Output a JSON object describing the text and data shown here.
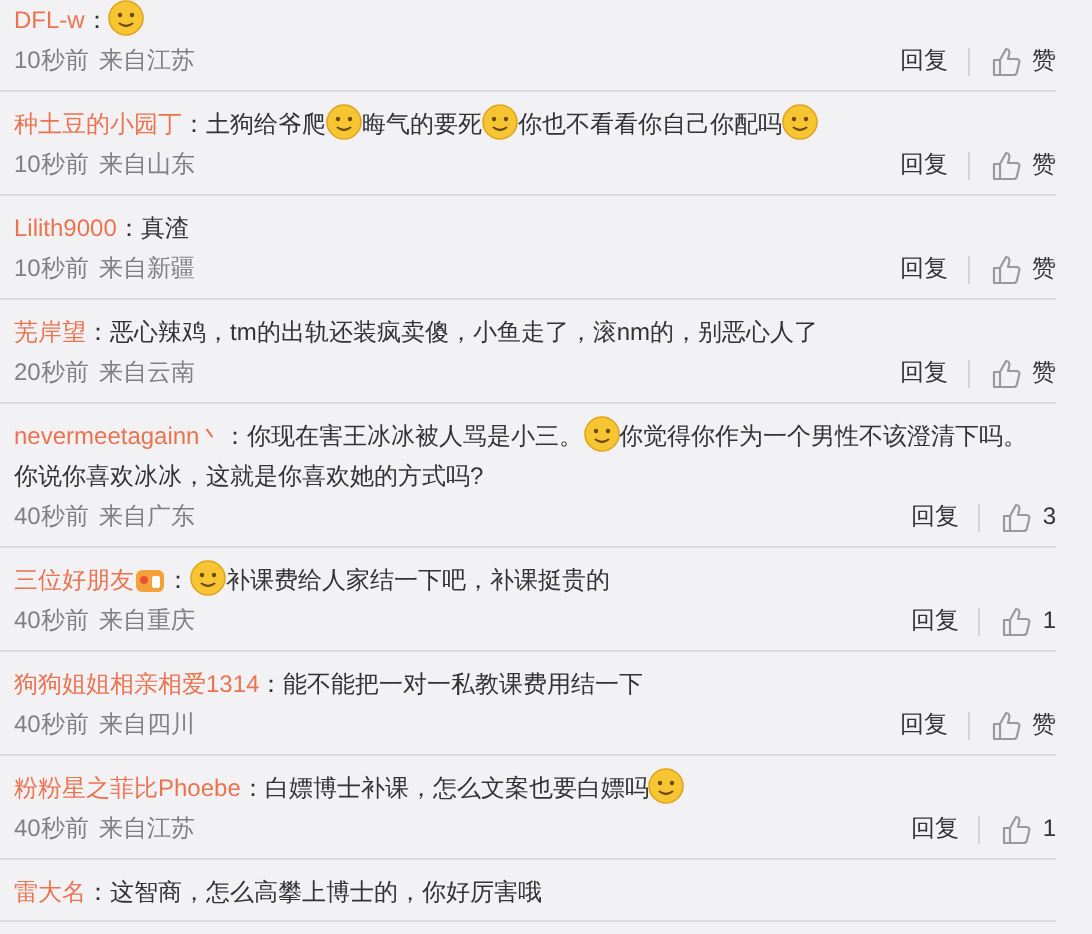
{
  "comments": [
    {
      "user": "DFL-w",
      "separator": "：",
      "content": [
        {
          "kind": "emoji"
        }
      ],
      "time": "10秒前",
      "location": "来自江苏",
      "reply": "回复",
      "likes": "赞"
    },
    {
      "user": "种土豆的小园丁",
      "separator": "：",
      "content": [
        {
          "kind": "text",
          "text": "土狗给爷爬"
        },
        {
          "kind": "emoji"
        },
        {
          "kind": "text",
          "text": "晦气的要死"
        },
        {
          "kind": "emoji"
        },
        {
          "kind": "text",
          "text": "你也不看看你自己你配吗"
        },
        {
          "kind": "emoji"
        }
      ],
      "time": "10秒前",
      "location": "来自山东",
      "reply": "回复",
      "likes": "赞"
    },
    {
      "user": "Lilith9000",
      "separator": "：",
      "content": [
        {
          "kind": "text",
          "text": "真渣"
        }
      ],
      "time": "10秒前",
      "location": "来自新疆",
      "reply": "回复",
      "likes": "赞"
    },
    {
      "user": "芜岸望",
      "separator": "：",
      "content": [
        {
          "kind": "text",
          "text": "恶心辣鸡，tm的出轨还装疯卖傻，小鱼走了，滚nm的，别恶心人了"
        }
      ],
      "time": "20秒前",
      "location": "来自云南",
      "reply": "回复",
      "likes": "赞"
    },
    {
      "user": "nevermeetagainn丶",
      "separator": "：",
      "content": [
        {
          "kind": "text",
          "text": "你现在害王冰冰被人骂是小三。"
        },
        {
          "kind": "emoji"
        },
        {
          "kind": "text",
          "text": "你觉得你作为一个男性不该澄清下吗。"
        },
        {
          "kind": "text",
          "text": "你说你喜欢冰冰，这就是你喜欢她的方式吗?"
        }
      ],
      "time": "40秒前",
      "location": "来自广东",
      "reply": "回复",
      "likes": "3"
    },
    {
      "user": "三位好朋友",
      "badge": true,
      "separator": "：",
      "content": [
        {
          "kind": "emoji"
        },
        {
          "kind": "text",
          "text": "补课费给人家结一下吧，补课挺贵的"
        }
      ],
      "time": "40秒前",
      "location": "来自重庆",
      "reply": "回复",
      "likes": "1"
    },
    {
      "user": "狗狗姐姐相亲相爱1314",
      "separator": "：",
      "content": [
        {
          "kind": "text",
          "text": "能不能把一对一私教课费用结一下"
        }
      ],
      "time": "40秒前",
      "location": "来自四川",
      "reply": "回复",
      "likes": "赞"
    },
    {
      "user": "粉粉星之菲比Phoebe",
      "separator": "：",
      "content": [
        {
          "kind": "text",
          "text": "白嫖博士补课，怎么文案也要白嫖吗"
        },
        {
          "kind": "emoji"
        }
      ],
      "time": "40秒前",
      "location": "来自江苏",
      "reply": "回复",
      "likes": "1"
    },
    {
      "user": "雷大名",
      "separator": "：",
      "content": [
        {
          "kind": "text",
          "text": "这智商，怎么高攀上博士的，你好厉害哦"
        }
      ]
    }
  ]
}
